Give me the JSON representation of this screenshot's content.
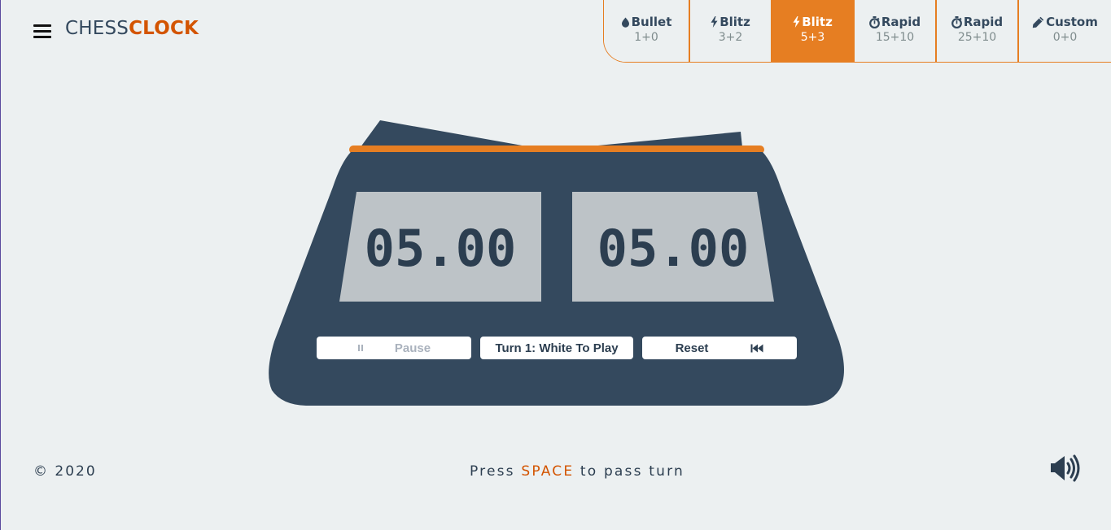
{
  "app": {
    "logo_part1": "CHESS",
    "logo_part2": "CLOCK"
  },
  "presets": [
    {
      "name": "Bullet",
      "time": "1+0",
      "icon": "bullet-icon",
      "active": false
    },
    {
      "name": "Blitz",
      "time": "3+2",
      "icon": "lightning-icon",
      "active": false
    },
    {
      "name": "Blitz",
      "time": "5+3",
      "icon": "lightning-icon",
      "active": true
    },
    {
      "name": "Rapid",
      "time": "15+10",
      "icon": "stopwatch-icon",
      "active": false
    },
    {
      "name": "Rapid",
      "time": "25+10",
      "icon": "stopwatch-icon",
      "active": false
    },
    {
      "name": "Custom",
      "time": "0+0",
      "icon": "pencil-icon",
      "active": false
    }
  ],
  "clock": {
    "left_time": "05.00",
    "right_time": "05.00"
  },
  "controls": {
    "pause_label": "Pause",
    "turn_label": "Turn 1: White To Play",
    "reset_label": "Reset"
  },
  "footer": {
    "copyright": "© 2020",
    "hint_before": "Press ",
    "hint_key": "SPACE",
    "hint_after": " to pass turn"
  },
  "colors": {
    "accent": "#e67e22",
    "accent_dark": "#d35400",
    "clock_body": "#34495e",
    "display_bg": "#bdc3c7",
    "background": "#ecf0f1"
  }
}
